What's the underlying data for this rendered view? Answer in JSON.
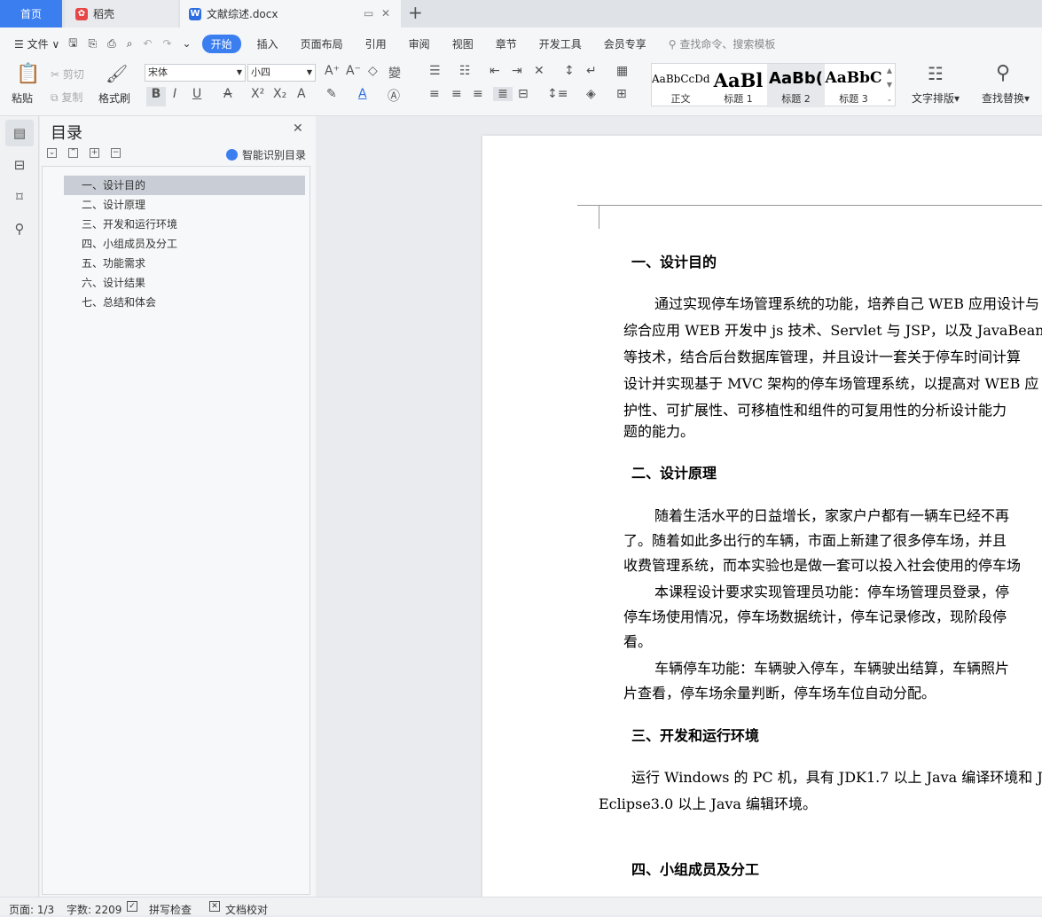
{
  "tabs": {
    "home": "首页",
    "daoke": "稻壳",
    "doc": "文献综述.docx"
  },
  "menu": {
    "file": "文件",
    "items": [
      "开始",
      "插入",
      "页面布局",
      "引用",
      "审阅",
      "视图",
      "章节",
      "开发工具",
      "会员专享"
    ],
    "search_placeholder": "查找命令、搜索模板"
  },
  "ribbon": {
    "paste": "粘贴",
    "cut": "剪切",
    "copy": "复制",
    "format_painter": "格式刷",
    "font": "宋体",
    "size": "小四",
    "styles": [
      {
        "preview": "AaBbCcDd",
        "name": "正文"
      },
      {
        "preview": "AaBl",
        "name": "标题 1"
      },
      {
        "preview": "AaBb(",
        "name": "标题 2"
      },
      {
        "preview": "AaBbC",
        "name": "标题 3"
      }
    ],
    "text_layout": "文字排版",
    "find_replace": "查找替换"
  },
  "nav": {
    "title": "目录",
    "smart": "智能识别目录",
    "items": [
      "一、设计目的",
      "二、设计原理",
      "三、开发和运行环境",
      "四、小组成员及分工",
      "五、功能需求",
      "六、设计结果",
      "七、总结和体会"
    ]
  },
  "doc": {
    "h1": "一、设计目的",
    "p1": [
      "通过实现停车场管理系统的功能，培养自己 WEB 应用设计与",
      "综合应用 WEB 开发中 js 技术、Servlet 与 JSP，以及 JavaBean",
      "等技术，结合后台数据库管理，并且设计一套关于停车时间计算",
      "设计并实现基于 MVC 架构的停车场管理系统，以提高对 WEB 应",
      "护性、可扩展性、可移植性和组件的可复用性的分析设计能力",
      "题的能力。"
    ],
    "h2": "二、设计原理",
    "p2": [
      "随着生活水平的日益增长，家家户户都有一辆车已经不再",
      "了。随着如此多出行的车辆，市面上新建了很多停车场，并且",
      "收费管理系统，而本实验也是做一套可以投入社会使用的停车场"
    ],
    "p3": [
      "本课程设计要求实现管理员功能：停车场管理员登录，停",
      "停车场使用情况，停车场数据统计，停车记录修改，现阶段停",
      "看。"
    ],
    "p4": [
      "车辆停车功能：车辆驶入停车，车辆驶出结算，车辆照片",
      "片查看，停车场余量判断，停车场车位自动分配。"
    ],
    "h3": "三、开发和运行环境",
    "p5": [
      "运行 Windows 的 PC 机，具有 JDK1.7 以上 Java 编译环境和 J",
      "Eclipse3.0 以上 Java 编辑环境。"
    ],
    "h4": "四、小组成员及分工"
  },
  "status": {
    "page": "页面: 1/3",
    "words": "字数: 2209",
    "spell": "拼写检查",
    "proof": "文档校对"
  }
}
